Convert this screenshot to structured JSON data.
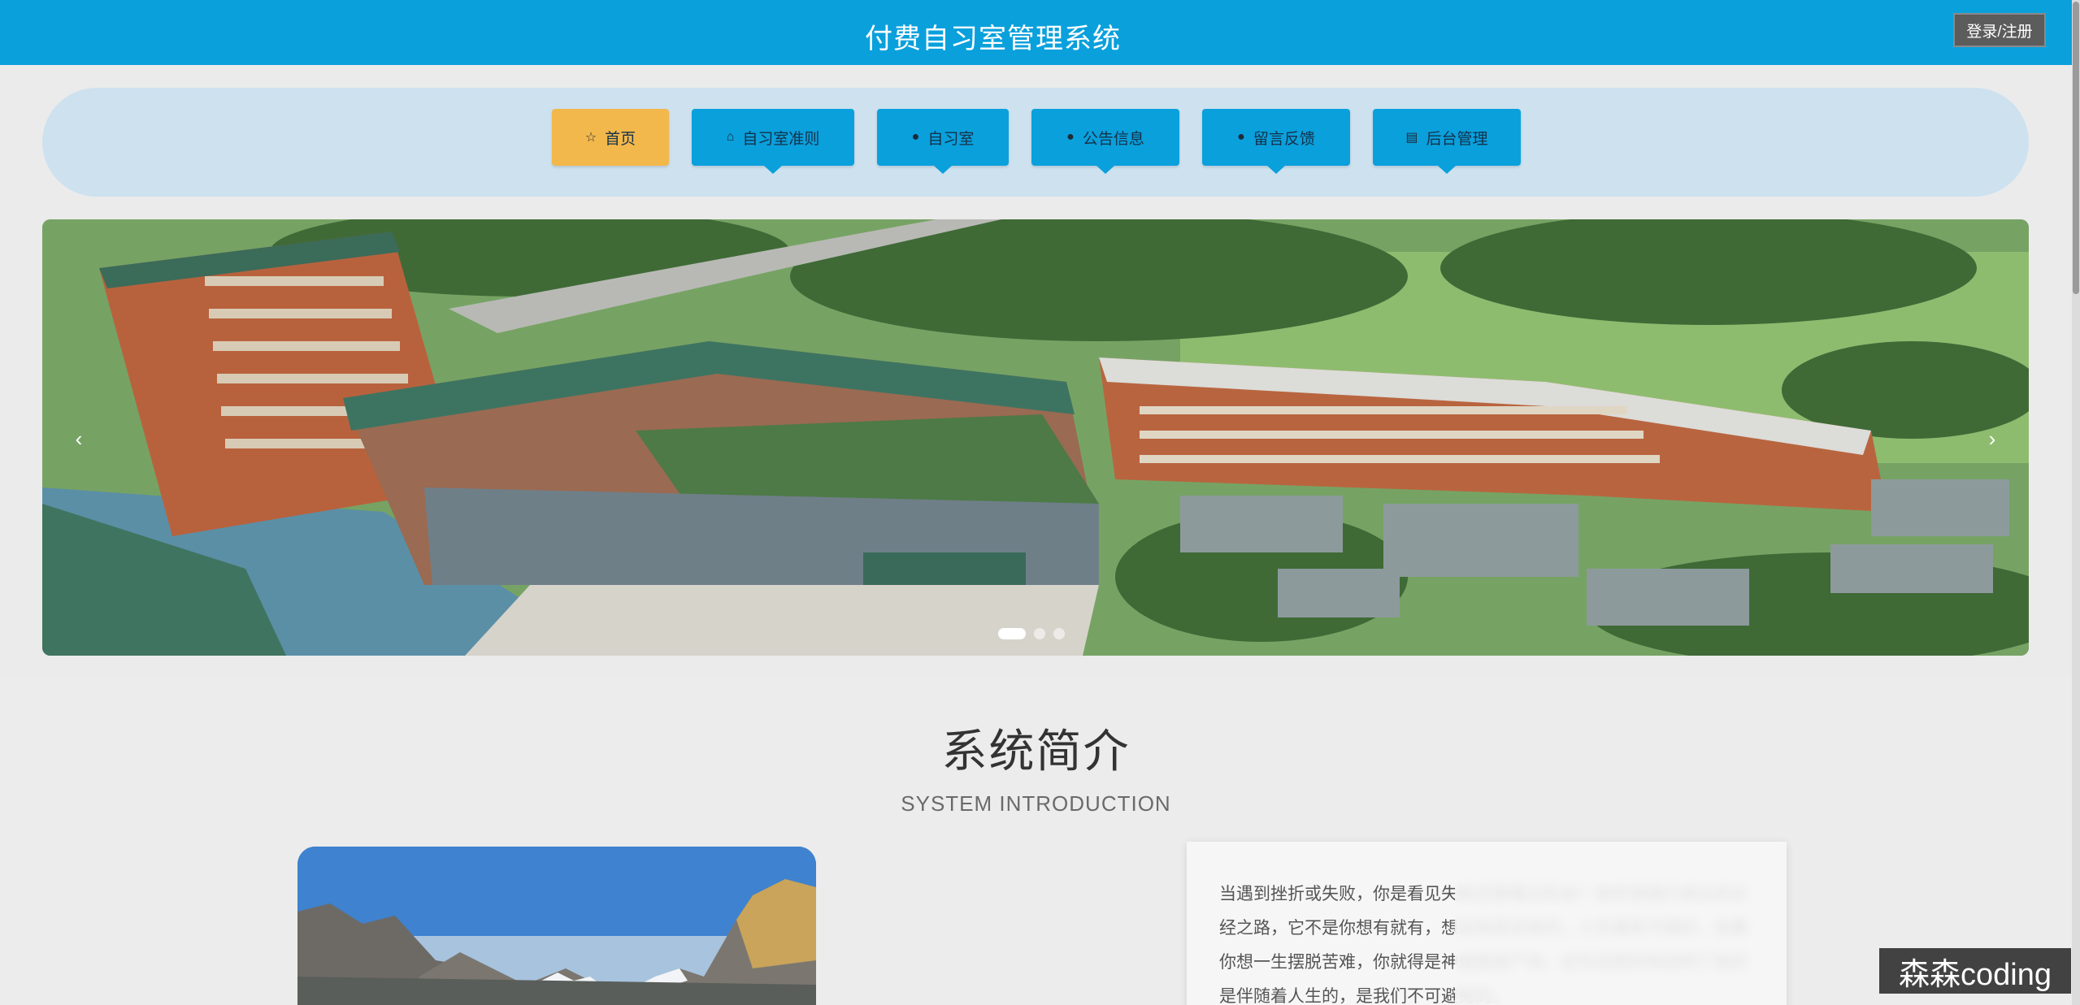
{
  "header": {
    "title": "付费自习室管理系统",
    "login_label": "登录/注册"
  },
  "nav": {
    "items": [
      {
        "label": "首页",
        "icon": "star-icon",
        "active": true
      },
      {
        "label": "自习室准则",
        "icon": "bag-icon",
        "active": false
      },
      {
        "label": "自习室",
        "icon": "info-circle-icon",
        "active": false
      },
      {
        "label": "公告信息",
        "icon": "question-circle-icon",
        "active": false
      },
      {
        "label": "留言反馈",
        "icon": "facebook-circle-icon",
        "active": false
      },
      {
        "label": "后台管理",
        "icon": "clipboard-icon",
        "active": false
      }
    ]
  },
  "banner": {
    "prev_glyph": "‹",
    "next_glyph": "›",
    "slide_count": 3,
    "active_slide": 1
  },
  "intro": {
    "title": "系统简介",
    "subtitle": "SYSTEM INTRODUCTION",
    "paragraph": "当遇到挫折或失败，你是看见失败还是看见机会？挫折是我们成长的必经之路，它不是你想有就有，想没有就没有的。人生难免不顺好，如果你想一生摆脱苦难，你就得是神或者是尸体。这句话很好地说明了挫折是伴随着人生的，是我们不可避免的。"
  },
  "watermark": "森森coding",
  "colors": {
    "header_bg": "#0aa0dc",
    "nav_bg": "#cde1ef",
    "nav_item": "#0aa0dc",
    "nav_active": "#f2b84b"
  }
}
